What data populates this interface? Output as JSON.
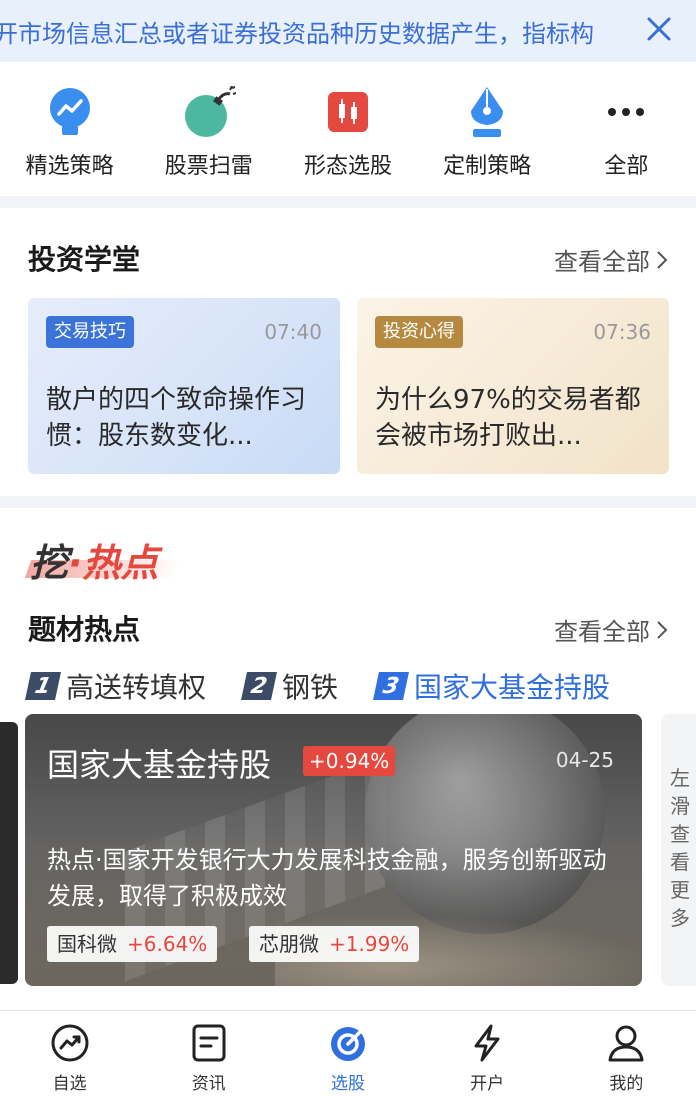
{
  "notice": {
    "text": "开市场信息汇总或者证券投资品种历史数据产生，指标构",
    "close_icon": "close-icon"
  },
  "tools": [
    {
      "label": "精选策略",
      "icon": "bulb-chart-icon"
    },
    {
      "label": "股票扫雷",
      "icon": "bomb-icon"
    },
    {
      "label": "形态选股",
      "icon": "candlestick-icon"
    },
    {
      "label": "定制策略",
      "icon": "pen-nib-icon"
    },
    {
      "label": "全部",
      "icon": "more-dots-icon"
    }
  ],
  "academy": {
    "title": "投资学堂",
    "see_all": "查看全部",
    "cards": [
      {
        "tag": "交易技巧",
        "time": "07:40",
        "title": "散户的四个致命操作习惯：股东数变化..."
      },
      {
        "tag": "投资心得",
        "time": "07:36",
        "title": "为什么97%的交易者都会被市场打败出..."
      }
    ]
  },
  "hot": {
    "brand_part1": "挖",
    "brand_part2": "·热点",
    "section_title": "题材热点",
    "see_all": "查看全部",
    "ranks": [
      {
        "num": "1",
        "label": "高送转填权"
      },
      {
        "num": "2",
        "label": "钢铁"
      },
      {
        "num": "3",
        "label": "国家大基金持股"
      }
    ],
    "banner": {
      "title": "国家大基金持股",
      "change": "+0.94%",
      "date": "04-25",
      "desc": "热点·国家开发银行大力发展科技金融，服务创新驱动发展，取得了积极成效",
      "stocks": [
        {
          "name": "国科微",
          "change": "+6.64%"
        },
        {
          "name": "芯朋微",
          "change": "+1.99%"
        }
      ]
    },
    "swipe_hint": "左滑查看更多"
  },
  "tabbar": [
    {
      "label": "自选",
      "icon": "trend-circle-icon"
    },
    {
      "label": "资讯",
      "icon": "document-icon"
    },
    {
      "label": "选股",
      "icon": "target-icon"
    },
    {
      "label": "开户",
      "icon": "lightning-icon"
    },
    {
      "label": "我的",
      "icon": "user-icon"
    }
  ],
  "colors": {
    "accent": "#2f6fe0",
    "up": "#e5483e",
    "notice_bg": "#e8f0fc"
  }
}
